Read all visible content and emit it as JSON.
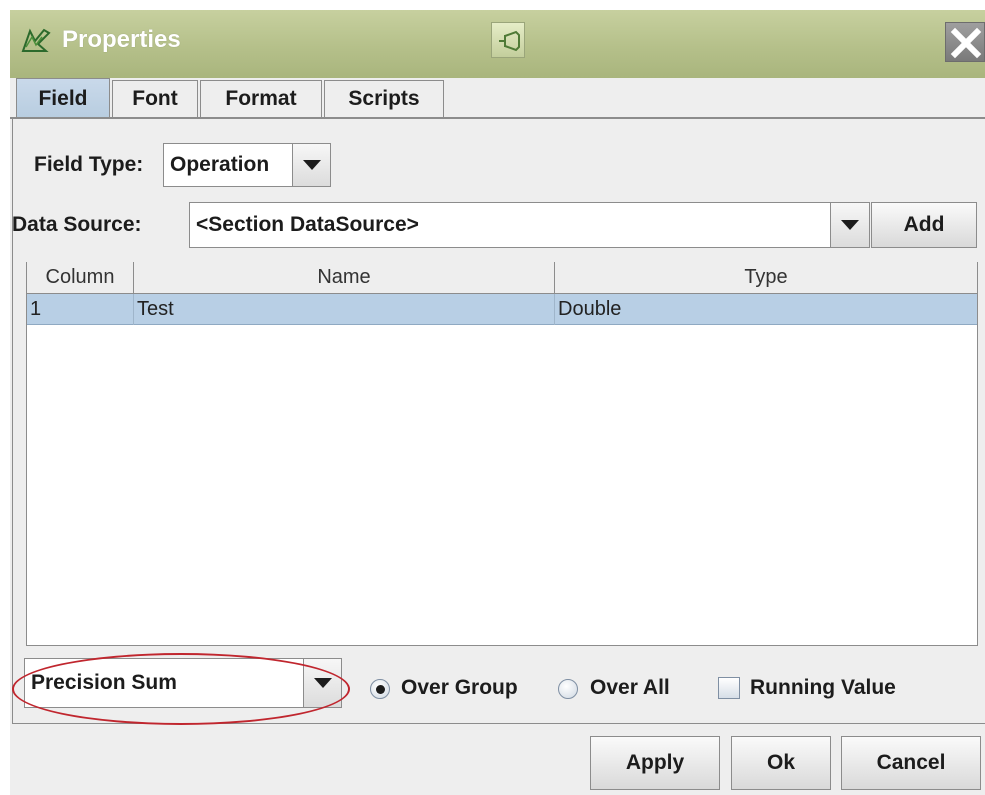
{
  "window": {
    "title": "Properties"
  },
  "tabs": [
    {
      "label": "Field",
      "active": true
    },
    {
      "label": "Font",
      "active": false
    },
    {
      "label": "Format",
      "active": false
    },
    {
      "label": "Scripts",
      "active": false
    }
  ],
  "field_type": {
    "label": "Field Type:",
    "value": "Operation"
  },
  "data_source": {
    "label": "Data Source:",
    "value": "<Section DataSource>",
    "add_label": "Add"
  },
  "table": {
    "columns": [
      "Column",
      "Name",
      "Type"
    ],
    "rows": [
      {
        "column": "1",
        "name": "Test",
        "type": "Double",
        "selected": true
      }
    ]
  },
  "operation": {
    "value": "Precision Sum"
  },
  "options": {
    "over_group": {
      "label": "Over Group",
      "selected": true
    },
    "over_all": {
      "label": "Over All",
      "selected": false
    },
    "running_value": {
      "label": "Running Value",
      "checked": false
    }
  },
  "buttons": {
    "apply": "Apply",
    "ok": "Ok",
    "cancel": "Cancel"
  },
  "icons": {
    "app": "properties-icon",
    "pin": "pin-icon",
    "close": "close-icon"
  },
  "colors": {
    "titlebar": "#b5c08a",
    "selection": "#b8cfe5",
    "annotation": "#c0262e"
  }
}
